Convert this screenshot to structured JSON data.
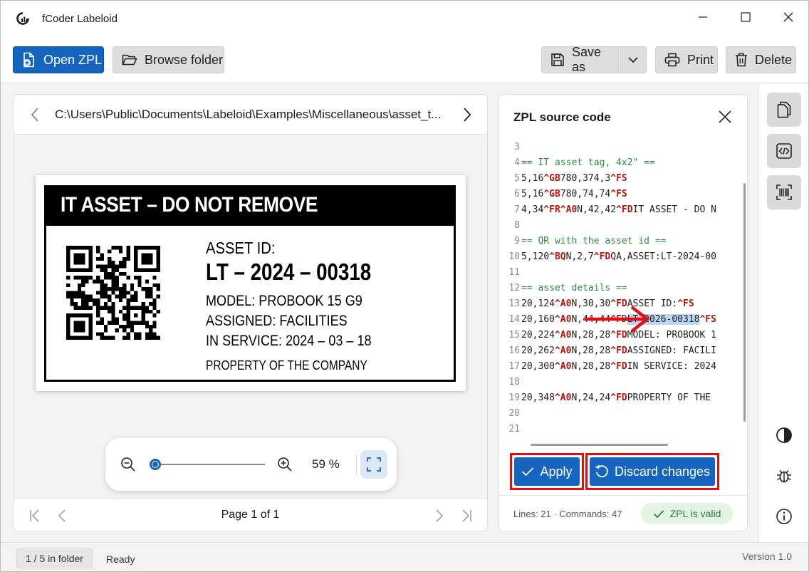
{
  "app": {
    "title": "fCoder Labeloid"
  },
  "toolbar": {
    "open_label": "Open ZPL",
    "browse_label": "Browse folder",
    "save_label": "Save as",
    "print_label": "Print",
    "delete_label": "Delete"
  },
  "preview": {
    "path": "C:\\Users\\Public\\Documents\\Labeloid\\Examples\\Miscellaneous\\asset_t...",
    "zoom": "59 %",
    "zoom_fraction": 0.05,
    "page_info": "Page 1 of 1"
  },
  "label": {
    "header": "IT ASSET  –  DO NOT REMOVE",
    "asset_id_label": "ASSET ID:",
    "asset_id": "LT – 2024 – 00318",
    "model": "MODEL: PROBOOK 15 G9",
    "assigned": "ASSIGNED: FACILITIES",
    "in_service": "IN SERVICE: 2024 – 03 – 18",
    "property": "PROPERTY OF THE COMPANY"
  },
  "code_panel": {
    "title": "ZPL source code",
    "lines": [
      {
        "num": "3",
        "parts": []
      },
      {
        "num": "4",
        "parts": [
          {
            "t": "== IT asset tag, 4x2\" ==",
            "c": "cm"
          }
        ]
      },
      {
        "num": "5",
        "parts": [
          {
            "t": "5,16",
            "c": ""
          },
          {
            "t": "^GB",
            "c": "kw"
          },
          {
            "t": "780,374,3",
            "c": ""
          },
          {
            "t": "^FS",
            "c": "kw"
          }
        ]
      },
      {
        "num": "6",
        "parts": [
          {
            "t": "5,16",
            "c": ""
          },
          {
            "t": "^GB",
            "c": "kw"
          },
          {
            "t": "780,74,74",
            "c": ""
          },
          {
            "t": "^FS",
            "c": "kw"
          }
        ]
      },
      {
        "num": "7",
        "parts": [
          {
            "t": "4,34",
            "c": ""
          },
          {
            "t": "^FR^A0",
            "c": "kw"
          },
          {
            "t": "N,42,42",
            "c": ""
          },
          {
            "t": "^FD",
            "c": "kw"
          },
          {
            "t": "IT ASSET - DO N",
            "c": ""
          }
        ]
      },
      {
        "num": "8",
        "parts": []
      },
      {
        "num": "9",
        "parts": [
          {
            "t": "== QR with the asset id ==",
            "c": "cm"
          }
        ]
      },
      {
        "num": "10",
        "parts": [
          {
            "t": "5,120",
            "c": ""
          },
          {
            "t": "^BQ",
            "c": "kw"
          },
          {
            "t": "N,2,7",
            "c": ""
          },
          {
            "t": "^FD",
            "c": "kw"
          },
          {
            "t": "QA,ASSET:LT-2024-00",
            "c": ""
          }
        ]
      },
      {
        "num": "11",
        "parts": []
      },
      {
        "num": "12",
        "parts": [
          {
            "t": "== asset details ==",
            "c": "cm"
          }
        ]
      },
      {
        "num": "13",
        "parts": [
          {
            "t": "20,124",
            "c": ""
          },
          {
            "t": "^A0",
            "c": "kw"
          },
          {
            "t": "N,30,30",
            "c": ""
          },
          {
            "t": "^FD",
            "c": "kw"
          },
          {
            "t": "ASSET ID:",
            "c": ""
          },
          {
            "t": "^FS",
            "c": "kw"
          }
        ]
      },
      {
        "num": "14",
        "parts": [
          {
            "t": "20,160",
            "c": ""
          },
          {
            "t": "^A0",
            "c": "kw"
          },
          {
            "t": "N,44,44",
            "c": ""
          },
          {
            "t": "^F",
            "c": "kw"
          },
          {
            "t": "D",
            "c": ""
          },
          {
            "t": "LT-2026-00318",
            "c": "sel"
          },
          {
            "t": "^FS",
            "c": "kw"
          }
        ]
      },
      {
        "num": "15",
        "parts": [
          {
            "t": "20,224",
            "c": ""
          },
          {
            "t": "^A0",
            "c": "kw"
          },
          {
            "t": "N,28,28",
            "c": ""
          },
          {
            "t": "^FD",
            "c": "kw"
          },
          {
            "t": "MODEL: PROBOOK 1",
            "c": ""
          }
        ]
      },
      {
        "num": "16",
        "parts": [
          {
            "t": "20,262",
            "c": ""
          },
          {
            "t": "^A0",
            "c": "kw"
          },
          {
            "t": "N,28,28",
            "c": ""
          },
          {
            "t": "^FD",
            "c": "kw"
          },
          {
            "t": "ASSIGNED: FACILI",
            "c": ""
          }
        ]
      },
      {
        "num": "17",
        "parts": [
          {
            "t": "20,300",
            "c": ""
          },
          {
            "t": "^A0",
            "c": "kw"
          },
          {
            "t": "N,28,28",
            "c": ""
          },
          {
            "t": "^FD",
            "c": "kw"
          },
          {
            "t": "IN SERVICE: 2024",
            "c": ""
          }
        ]
      },
      {
        "num": "18",
        "parts": []
      },
      {
        "num": "19",
        "parts": [
          {
            "t": "20,348",
            "c": ""
          },
          {
            "t": "^A0",
            "c": "kw"
          },
          {
            "t": "N,24,24",
            "c": ""
          },
          {
            "t": "^FD",
            "c": "kw"
          },
          {
            "t": "PROPERTY OF THE",
            "c": ""
          }
        ]
      },
      {
        "num": "20",
        "parts": []
      },
      {
        "num": "21",
        "parts": []
      }
    ],
    "apply_label": "Apply",
    "discard_label": "Discard changes",
    "stats": "Lines: 21 · Commands: 47",
    "valid_label": "ZPL is valid"
  },
  "status": {
    "folder_position": "1 / 5 in folder",
    "text": "Ready",
    "version": "Version 1.0"
  },
  "colors": {
    "accent": "#1565c0",
    "annotation": "#e01010",
    "valid": "#2e7d32"
  }
}
